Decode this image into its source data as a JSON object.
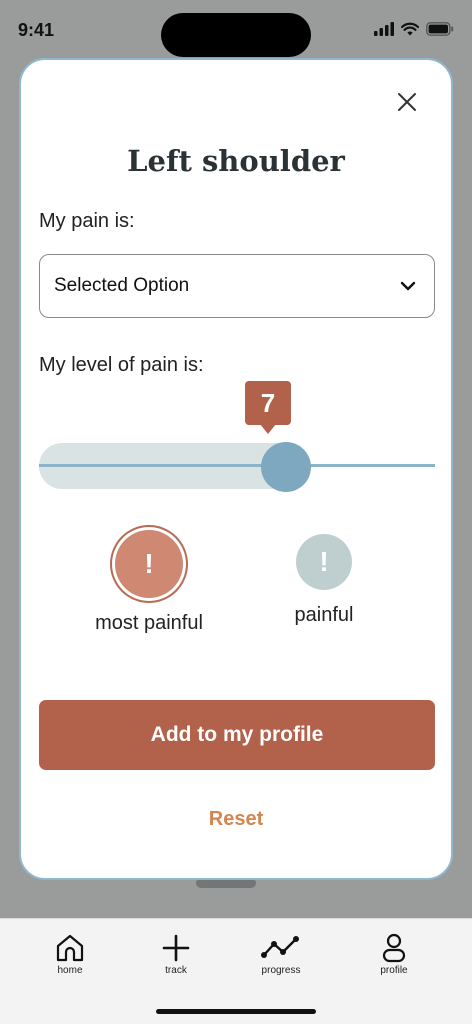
{
  "status_bar": {
    "time": "9:41"
  },
  "modal": {
    "title": "Left shoulder",
    "pain_type_label": "My pain is:",
    "pain_type_select": {
      "value": "Selected Option"
    },
    "pain_level_label": "My level of pain is:",
    "pain_level": {
      "value": "7",
      "fraction": 0.62
    },
    "pain_options": [
      {
        "label": "most painful",
        "symbol": "!",
        "selected": true
      },
      {
        "label": "painful",
        "symbol": "!",
        "selected": false
      }
    ],
    "primary_button": "Add to my profile",
    "reset_link": "Reset"
  },
  "bottom_nav": {
    "items": [
      {
        "label": "home",
        "icon": "home-icon"
      },
      {
        "label": "track",
        "icon": "plus-icon"
      },
      {
        "label": "progress",
        "icon": "progress-icon"
      },
      {
        "label": "profile",
        "icon": "profile-icon"
      }
    ]
  },
  "colors": {
    "accent": "#b2614a",
    "slider": "#7ea8c0",
    "reset": "#d68450"
  }
}
